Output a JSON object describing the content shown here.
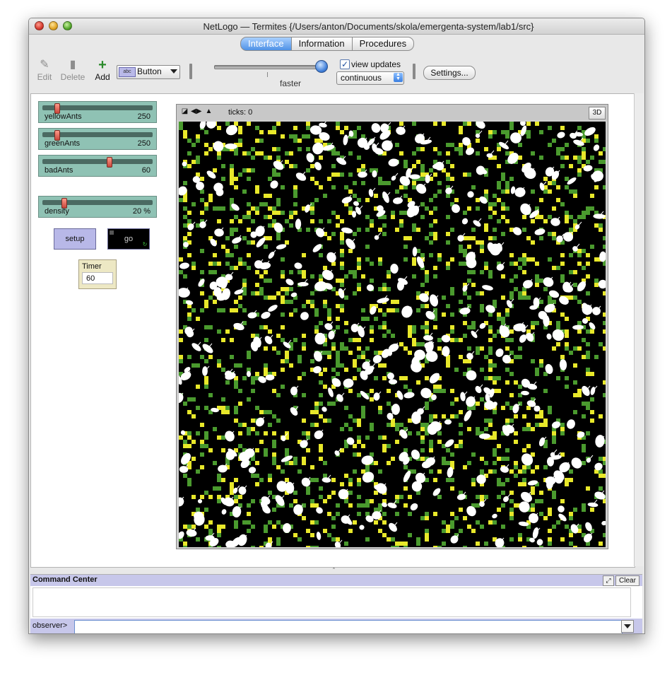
{
  "window": {
    "title": "NetLogo — Termites {/Users/anton/Documents/skola/emergenta-system/lab1/src}"
  },
  "tabs": [
    {
      "label": "Interface",
      "active": true
    },
    {
      "label": "Information",
      "active": false
    },
    {
      "label": "Procedures",
      "active": false
    }
  ],
  "toolbar": {
    "edit_label": "Edit",
    "delete_label": "Delete",
    "add_label": "Add",
    "widget_type": "Button",
    "widget_badge": "abc",
    "speed_label": "faster",
    "speed_fraction": 1.0,
    "view_updates_label": "view updates",
    "view_updates_checked": true,
    "update_mode": "continuous",
    "settings_label": "Settings..."
  },
  "sliders": [
    {
      "name": "yellowAnts",
      "value": "250",
      "position": 0.12
    },
    {
      "name": "greenAnts",
      "value": "250",
      "position": 0.12
    },
    {
      "name": "badAnts",
      "value": "60",
      "position": 0.6
    },
    {
      "name": "density",
      "value": "20 %",
      "position": 0.2
    }
  ],
  "buttons": {
    "setup_label": "setup",
    "go_label": "go"
  },
  "monitor": {
    "name": "Timer",
    "value": "60"
  },
  "view": {
    "ticks_label": "ticks: 0",
    "btn_3d": "3D",
    "colors": {
      "background": "#000000",
      "yellow": "#e8e82a",
      "green": "#4a9a2e",
      "ant": "#ffffff"
    }
  },
  "command_center": {
    "title": "Command Center",
    "clear_label": "Clear",
    "prompt": "observer>",
    "input_value": ""
  }
}
